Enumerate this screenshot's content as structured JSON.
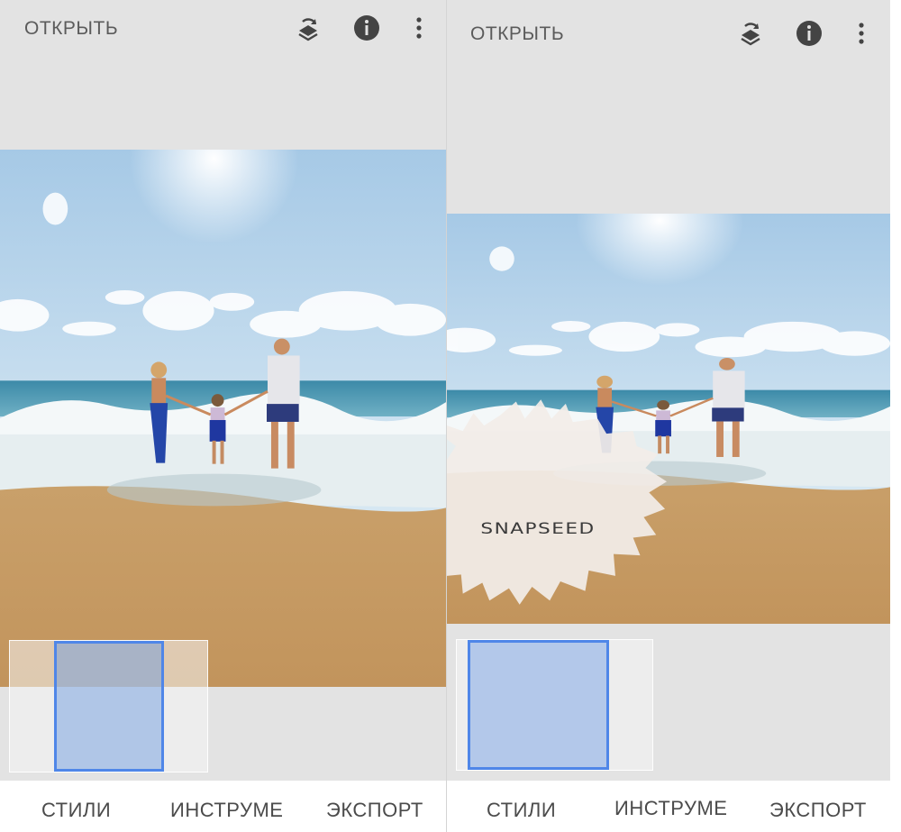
{
  "screens": [
    {
      "toolbar": {
        "open_label": "ОТКРЫТЬ",
        "icons": [
          "layers-undo-icon",
          "info-icon",
          "more-vert-icon"
        ]
      },
      "bottom_nav": [
        "СТИЛИ",
        "ИНСТРУМЕ",
        "ЭКСПОРТ"
      ]
    },
    {
      "toolbar": {
        "open_label": "ОТКРЫТЬ",
        "icons": [
          "layers-undo-icon",
          "info-icon",
          "more-vert-icon"
        ]
      },
      "watermark": {
        "text": "SNAPSEED"
      },
      "bottom_nav": [
        "СТИЛИ",
        "ИНСТРУМЕ",
        "ЭКСПОРТ"
      ]
    }
  ],
  "colors": {
    "background": "#e3e3e3",
    "selection_blue": "#4f86e8",
    "text": "#4b4b4b"
  }
}
